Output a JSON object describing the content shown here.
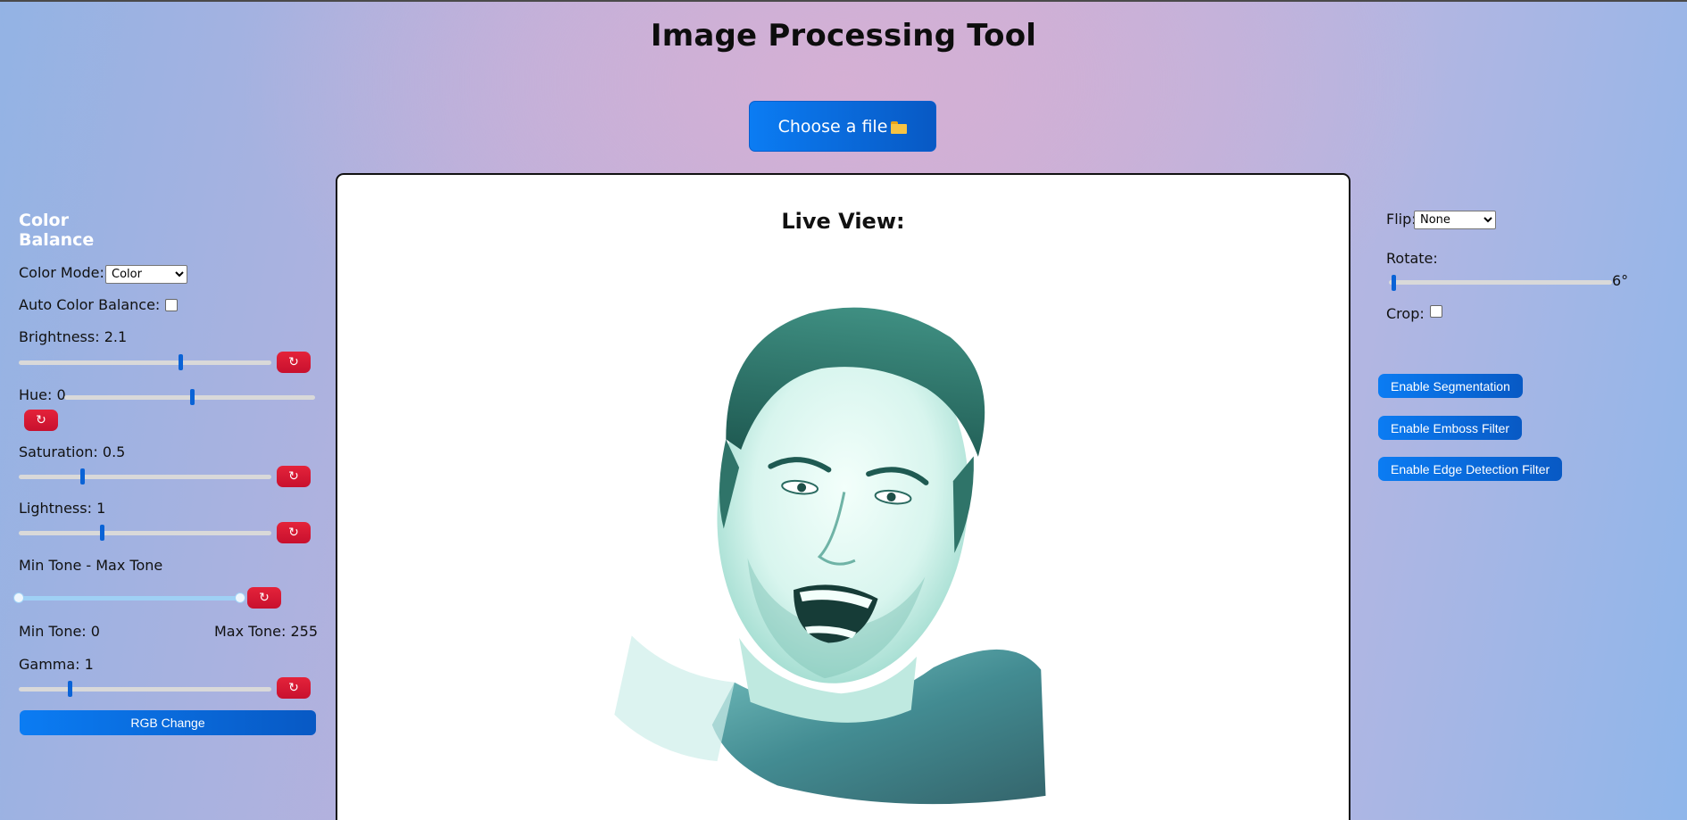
{
  "app": {
    "title": "Image Processing Tool",
    "file_button_label": "Choose a file",
    "file_button_icon": "folder-icon"
  },
  "left_panel": {
    "section_title": "Color Balance",
    "color_mode": {
      "label": "Color Mode:",
      "value": "Color",
      "options": [
        "Color"
      ]
    },
    "auto_color_balance": {
      "label": "Auto Color Balance:",
      "checked": false
    },
    "brightness": {
      "label": "Brightness: 2.1",
      "position": 0.64
    },
    "hue": {
      "label": "Hue: 0",
      "position": 0.51
    },
    "saturation": {
      "label": "Saturation: 0.5",
      "position": 0.25
    },
    "lightness": {
      "label": "Lightness: 1",
      "position": 0.33
    },
    "tone_range": {
      "label": "Min Tone - Max Tone",
      "min_label": "Min Tone: 0",
      "max_label": "Max Tone: 255",
      "min": 0,
      "max": 255
    },
    "gamma": {
      "label": "Gamma: 1",
      "position": 0.2
    },
    "reset_icon": "↻",
    "rgb_button_label": "RGB Change"
  },
  "center": {
    "live_title": "Live View:"
  },
  "right_panel": {
    "flip": {
      "label": "Flip:",
      "value": "None",
      "options": [
        "None"
      ]
    },
    "rotate": {
      "label": "Rotate:",
      "value_text": "6°",
      "position": 0.02
    },
    "crop": {
      "label": "Crop:",
      "checked": false
    },
    "buttons": {
      "segmentation": "Enable Segmentation",
      "emboss": "Enable Emboss Filter",
      "edge": "Enable Edge Detection Filter"
    }
  },
  "colors": {
    "accent_blue": "#0b7cf3",
    "reset_red": "#e4233a",
    "panel_title": "#ffffff"
  }
}
